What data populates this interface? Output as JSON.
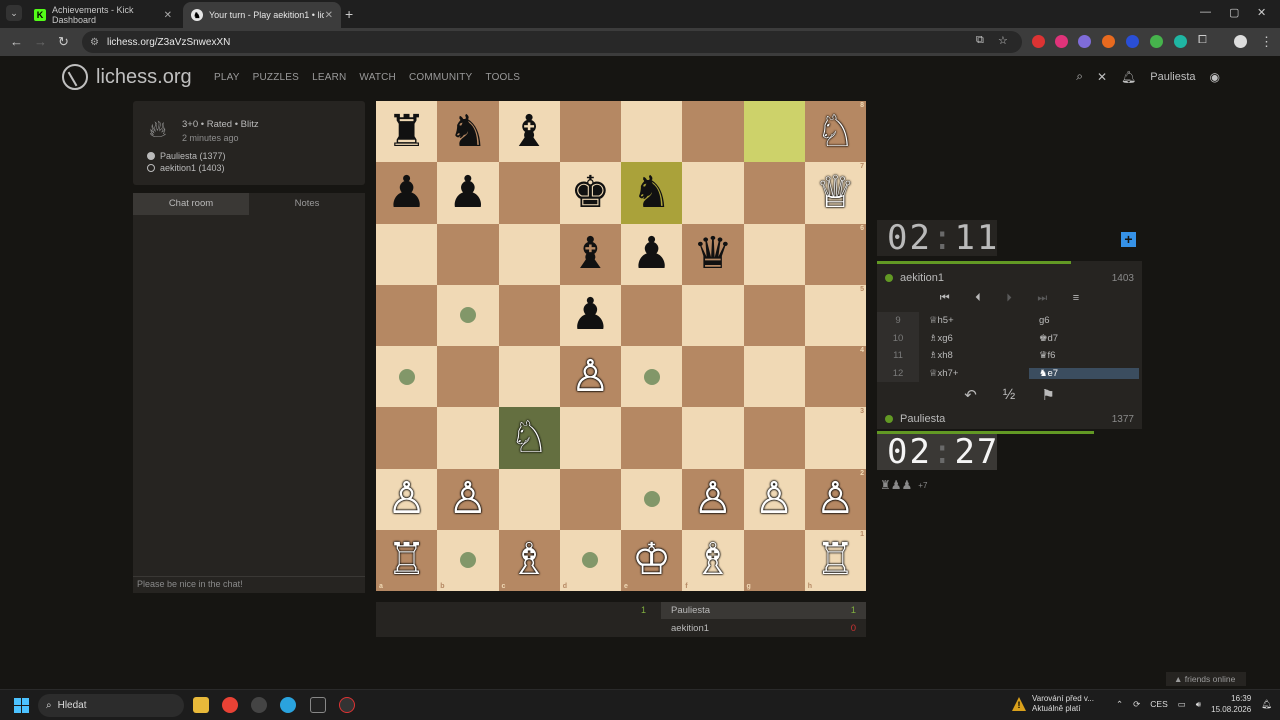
{
  "browser": {
    "tabs": [
      {
        "title": "Achievements - Kick Dashboard",
        "icon": "kick-logo-icon"
      },
      {
        "title": "Your turn - Play aekition1 • lich",
        "icon": "lichess-logo-icon"
      }
    ],
    "url": "lichess.org/Z3aVzSnwexXN"
  },
  "header": {
    "logo_text": "lichess.org",
    "nav": [
      "PLAY",
      "PUZZLES",
      "LEARN",
      "WATCH",
      "COMMUNITY",
      "TOOLS"
    ],
    "username": "Pauliesta"
  },
  "game": {
    "meta": "3+0 • Rated • Blitz",
    "ago": "2 minutes ago",
    "white_player": "Pauliesta (1377)",
    "black_player": "aekition1 (1403)"
  },
  "chat": {
    "tabs": [
      "Chat room",
      "Notes"
    ],
    "placeholder": "Please be nice in the chat!"
  },
  "board": {
    "ranks": [
      "8",
      "7",
      "6",
      "5",
      "4",
      "3",
      "2",
      "1"
    ],
    "files": [
      "a",
      "b",
      "c",
      "d",
      "e",
      "f",
      "g",
      "h"
    ],
    "pieces": [
      [
        "♜b",
        "♞b",
        "♝b",
        "",
        "",
        "",
        "",
        "♘w"
      ],
      [
        "♟b",
        "♟b",
        "",
        "♚b",
        "♞b",
        "",
        "",
        "♕w"
      ],
      [
        "",
        "",
        "",
        "♝b",
        "♟b",
        "♛b",
        "",
        ""
      ],
      [
        "",
        "",
        "",
        "♟b",
        "",
        "",
        "",
        ""
      ],
      [
        "",
        "",
        "",
        "♙w",
        "",
        "",
        "",
        ""
      ],
      [
        "",
        "",
        "♘w",
        "",
        "",
        "",
        "",
        ""
      ],
      [
        "♙w",
        "♙w",
        "",
        "",
        "",
        "♙w",
        "♙w",
        "♙w"
      ],
      [
        "♖w",
        "",
        "♗w",
        "",
        "♔w",
        "♗w",
        "",
        "♖w"
      ]
    ]
  },
  "clocks": {
    "opponent": {
      "min": "02",
      "sec": "11",
      "name": "aekition1",
      "rating": "1403"
    },
    "player": {
      "min": "02",
      "sec": "27",
      "name": "Pauliesta",
      "rating": "1377"
    }
  },
  "moves": [
    {
      "n": "9",
      "w": "♕h5+",
      "b": "g6"
    },
    {
      "n": "10",
      "w": "♗xg6",
      "b": "♚d7"
    },
    {
      "n": "11",
      "w": "♗xh8",
      "b": "♛f6"
    },
    {
      "n": "12",
      "w": "♕xh7+",
      "b": "♞e7"
    }
  ],
  "material": {
    "pieces": "♜♟♟",
    "diff": "+7"
  },
  "score": {
    "round": "1",
    "rows": [
      {
        "name": "Pauliesta",
        "score": "1"
      },
      {
        "name": "aekition1",
        "score": "0"
      }
    ]
  },
  "friends": "▲ friends online",
  "taskbar": {
    "search": "Hledat",
    "warning_line1": "Varování před v...",
    "warning_line2": "Aktuálně platí",
    "lang": "CES",
    "time": "16:39",
    "date": "15.08.2026"
  },
  "colors": {
    "accent_green": "#629924",
    "board_light": "#f0d9b5",
    "board_dark": "#b58863"
  }
}
